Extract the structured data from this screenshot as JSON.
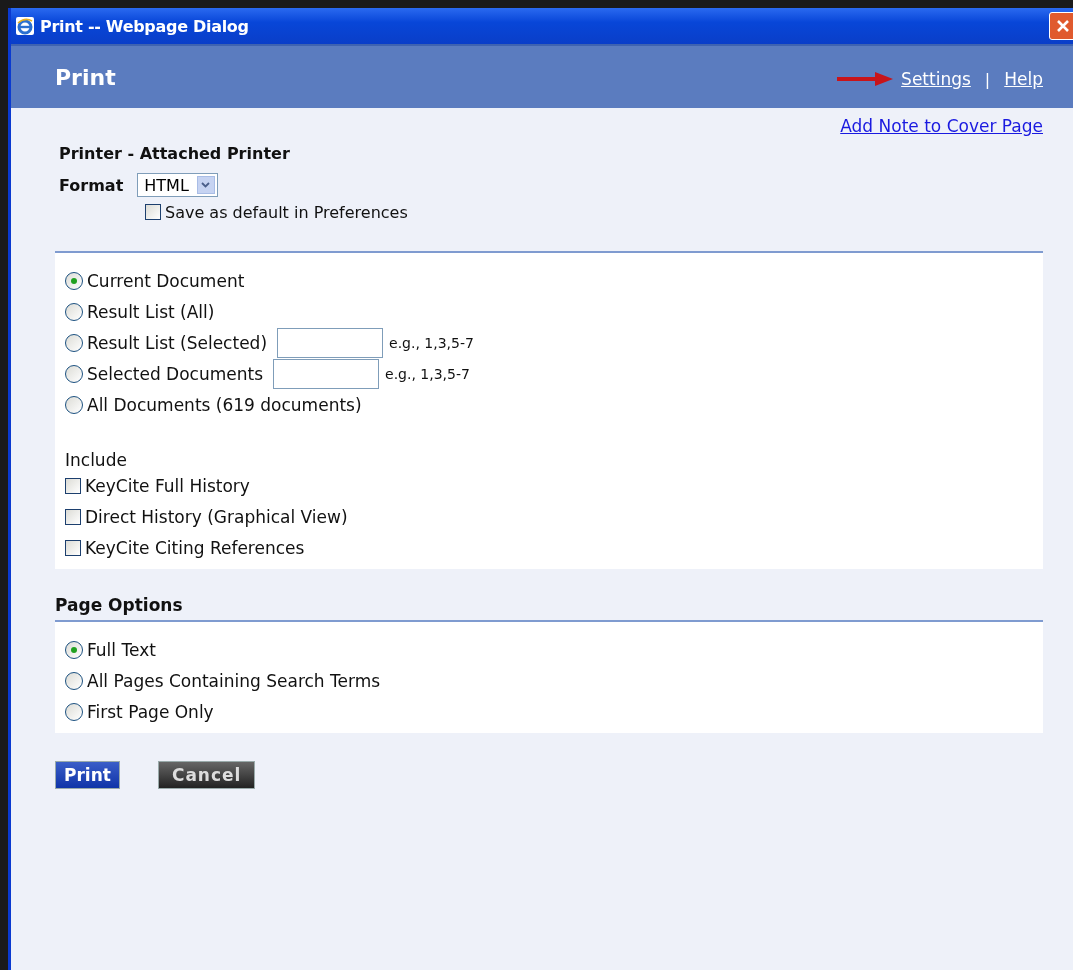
{
  "window": {
    "title": "Print -- Webpage Dialog"
  },
  "header": {
    "title": "Print",
    "links": [
      {
        "label": "Settings"
      },
      {
        "label": "Help"
      }
    ],
    "separator": "|"
  },
  "cover_note_link": "Add Note to Cover Page",
  "printer": {
    "label": "Printer - Attached Printer",
    "format_label": "Format",
    "format_value": "HTML",
    "save_default": {
      "label": "Save as default in Preferences",
      "checked": false
    }
  },
  "scope": [
    {
      "label": "Current Document",
      "selected": true
    },
    {
      "label": "Result List (All)",
      "selected": false
    },
    {
      "label": "Result List (Selected)",
      "selected": false,
      "hint": "e.g., 1,3,5-7"
    },
    {
      "label": "Selected Documents",
      "selected": false,
      "hint": "e.g., 1,3,5-7"
    },
    {
      "label": "All Documents (619 documents)",
      "selected": false
    }
  ],
  "include": {
    "heading": "Include",
    "items": [
      {
        "label": "KeyCite Full History",
        "checked": false
      },
      {
        "label": "Direct History (Graphical View)",
        "checked": false
      },
      {
        "label": "KeyCite Citing References",
        "checked": false
      }
    ]
  },
  "page_options": {
    "heading": "Page Options",
    "items": [
      {
        "label": "Full Text",
        "selected": true
      },
      {
        "label": "All Pages Containing Search Terms",
        "selected": false
      },
      {
        "label": "First Page Only",
        "selected": false
      }
    ]
  },
  "buttons": [
    {
      "label": "Print",
      "kind": "primary"
    },
    {
      "label": "Cancel",
      "kind": "secondary"
    }
  ]
}
